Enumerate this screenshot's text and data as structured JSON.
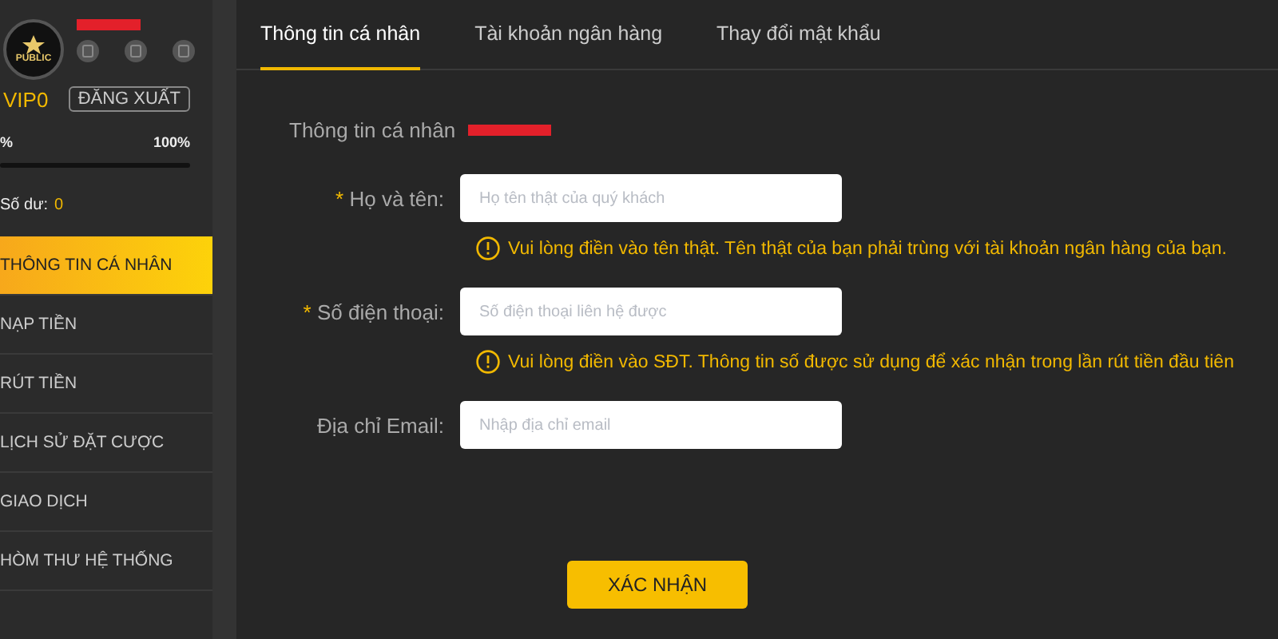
{
  "profile": {
    "logo": "PUBLIC",
    "level_name": "VIP0",
    "logout": "ĐĂNG XUẤT",
    "progress_start": "%",
    "progress_end": "100%",
    "level": 0,
    "balance_label": "Số dư:",
    "balance": "0"
  },
  "menu": [
    {
      "label": "THÔNG TIN CÁ NHÂN",
      "selected": true
    },
    {
      "label": "NẠP TIỀN",
      "selected": false
    },
    {
      "label": "RÚT TIỀN",
      "selected": false
    },
    {
      "label": "LỊCH SỬ ĐẶT CƯỢC",
      "selected": false
    },
    {
      "label": "GIAO DỊCH",
      "selected": false
    },
    {
      "label": "HÒM THƯ HỆ THỐNG",
      "selected": false
    }
  ],
  "tabs": [
    {
      "label": "Thông tin cá nhân",
      "selected": true
    },
    {
      "label": "Tài khoản ngân hàng",
      "selected": false
    },
    {
      "label": "Thay đổi mật khẩu",
      "selected": false
    }
  ],
  "section_title": "Thông tin cá nhân",
  "fields": [
    {
      "label": "Họ và tên:",
      "required_mark": "*",
      "placeholder": "Họ tên thật của quý khách",
      "hint": "Vui lòng điền vào tên thật. Tên thật của bạn phải trùng với tài khoản ngân hàng của bạn."
    },
    {
      "label": "Số điện thoại:",
      "required_mark": "*",
      "placeholder": "Số điện thoại liên hệ được",
      "hint": "Vui lòng điền vào SĐT. Thông tin số được sử dụng để xác nhận trong lần rút tiền đầu tiên"
    },
    {
      "label": "Địa chỉ Email:",
      "placeholder": "Nhập địa chỉ email"
    }
  ],
  "submit": "XÁC NHẬN"
}
